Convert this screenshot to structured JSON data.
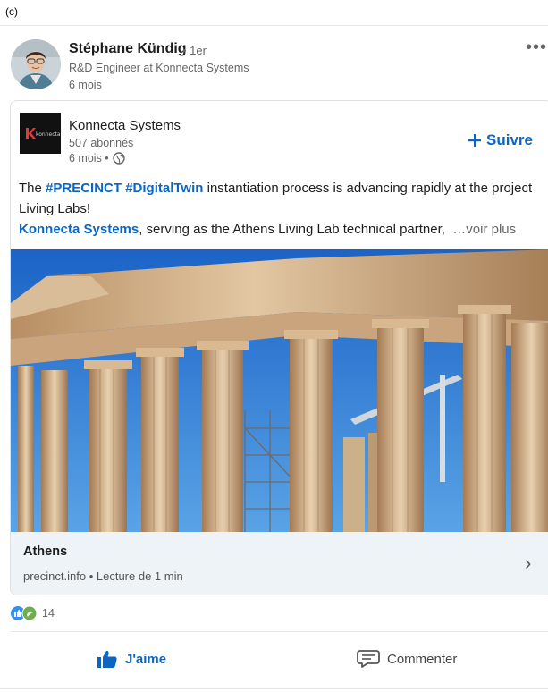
{
  "figure_label": "(c)",
  "author": {
    "name": "Stéphane Kündig",
    "degree": "• 1er",
    "role": "R&D Engineer at Konnecta Systems",
    "time": "6 mois"
  },
  "company": {
    "name": "Konnecta Systems",
    "logo_text": "konnecta",
    "followers": "507 abonnés",
    "time": "6 mois •",
    "follow_label": "Suivre",
    "follow_icon": "plus-icon"
  },
  "post": {
    "line1_pre": "The ",
    "tag1": "#PRECINCT",
    "line1_mid": " ",
    "tag2": "#DigitalTwin",
    "line1_post": " instantiation process is advancing rapidly at the project Living Labs!",
    "link": "Konnecta Systems",
    "line2_post": ", serving as the Athens Living Lab technical partner,",
    "more": "…voir plus"
  },
  "article": {
    "title": "Athens",
    "source": "precinct.info • Lecture de 1 min",
    "chevron": "›"
  },
  "reactions": {
    "icons": [
      "like-icon",
      "support-icon"
    ],
    "count": "14"
  },
  "actions": {
    "like_label": "J'aime",
    "comment_label": "Commenter"
  },
  "colors": {
    "accent": "#0a66c2",
    "card_meta_bg": "#eef3f8",
    "muted_text": "#666666"
  }
}
